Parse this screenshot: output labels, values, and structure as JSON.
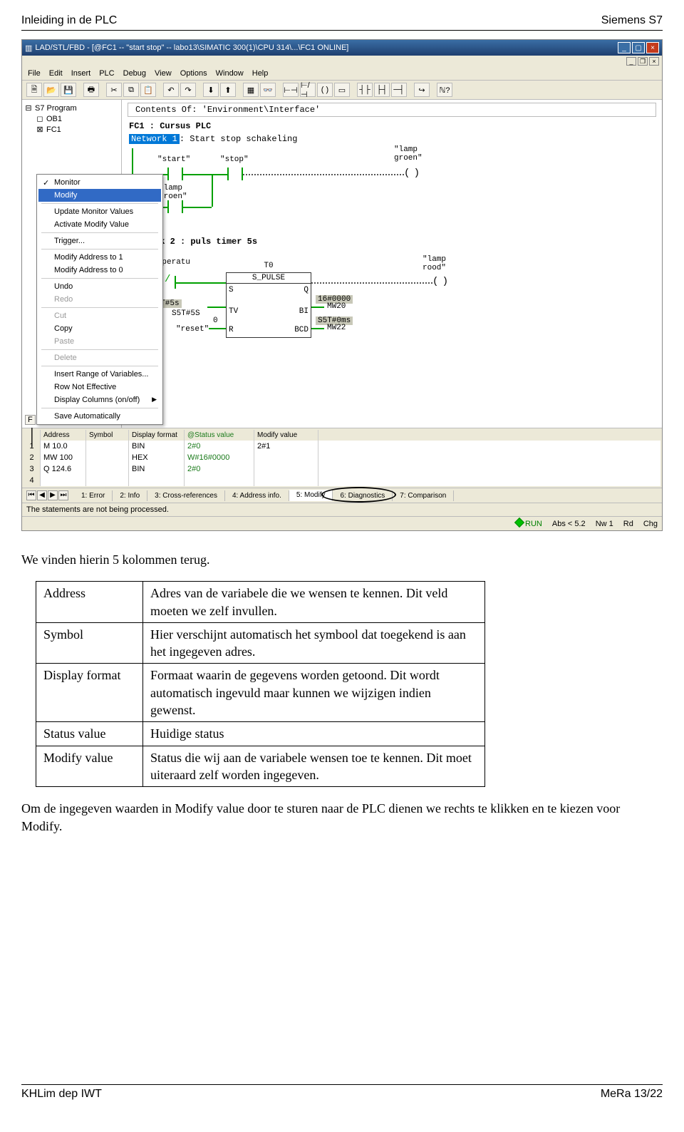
{
  "doc": {
    "header_left": "Inleiding in de PLC",
    "header_right": "Siemens S7",
    "footer_left": "KHLim dep IWT",
    "footer_right": "MeRa 13/22"
  },
  "win": {
    "title": "LAD/STL/FBD - [@FC1 -- \"start stop\" -- labo13\\SIMATIC 300(1)\\CPU 314\\...\\FC1  ONLINE]",
    "menus": [
      "File",
      "Edit",
      "Insert",
      "PLC",
      "Debug",
      "View",
      "Options",
      "Window",
      "Help"
    ],
    "env_title": "Contents Of: 'Environment\\Interface'",
    "tree": [
      {
        "icon": "⊟",
        "label": "S7 Program"
      },
      {
        "icon": "◻",
        "label": "OB1"
      },
      {
        "icon": "⊠",
        "label": "FC1"
      }
    ],
    "fc_title": "FC1 : Cursus PLC",
    "net1_title": "Network 1: Start stop schakeling",
    "net1": {
      "start": "\"start\"",
      "stop": "\"stop\"",
      "lamp": "\"lamp\ngroen\"",
      "feedback": "\"lamp\ngroen\""
    },
    "net2_title": "Network 2 : puls timer 5s",
    "net2": {
      "temp": "\"temperatu\nur\"",
      "t0": "T0",
      "spulse": "S_PULSE",
      "reset": "\"reset\"",
      "lamp_rood": "\"lamp\nrood\"",
      "s5t5s": "S5T#5s",
      "s5t5s_tv": "S5T#5S",
      "zero": "0",
      "hex0": "16#0000",
      "mw20": "MW20",
      "s5t0ms": "S5T#0ms",
      "mw22": "MW22",
      "pin_s": "S",
      "pin_q": "Q",
      "pin_tv": "TV",
      "pin_bi": "BI",
      "pin_r": "R",
      "pin_bcd": "BCD"
    },
    "context_menu": [
      {
        "label": "Monitor",
        "checked": true
      },
      {
        "label": "Modify",
        "selected": true
      },
      {
        "sep": true
      },
      {
        "label": "Update Monitor Values"
      },
      {
        "label": "Activate Modify Value"
      },
      {
        "sep": true
      },
      {
        "label": "Trigger...",
        "arrow": false
      },
      {
        "sep": true
      },
      {
        "label": "Modify Address to 1"
      },
      {
        "label": "Modify Address to 0"
      },
      {
        "sep": true
      },
      {
        "label": "Undo"
      },
      {
        "label": "Redo",
        "disabled": true
      },
      {
        "sep": true
      },
      {
        "label": "Cut",
        "disabled": true
      },
      {
        "label": "Copy"
      },
      {
        "label": "Paste",
        "disabled": true
      },
      {
        "sep": true
      },
      {
        "label": "Delete",
        "disabled": true
      },
      {
        "sep": true
      },
      {
        "label": "Insert Range of Variables..."
      },
      {
        "label": "Row Not Effective"
      },
      {
        "label": "Display Columns (on/off)",
        "arrow": true
      },
      {
        "sep": true
      },
      {
        "label": "Save Automatically"
      }
    ],
    "vat_headers": {
      "addr": "Address",
      "sym": "Symbol",
      "fmt": "Display format",
      "stat": "@Status value",
      "mod": "Modify value"
    },
    "vat_rows": [
      {
        "n": "1",
        "addr": "M    10.0",
        "sym": "",
        "fmt": "BIN",
        "stat": "2#0",
        "mod": "2#1"
      },
      {
        "n": "2",
        "addr": "MW   100",
        "sym": "",
        "fmt": "HEX",
        "stat": "W#16#0000",
        "mod": ""
      },
      {
        "n": "3",
        "addr": "Q    124.6",
        "sym": "",
        "fmt": "BIN",
        "stat": "2#0",
        "mod": ""
      },
      {
        "n": "4",
        "addr": "",
        "sym": "",
        "fmt": "",
        "stat": "",
        "mod": ""
      }
    ],
    "bottom_tabs": [
      "1: Error",
      "2: Info",
      "3: Cross-references",
      "4: Address info.",
      "5: Modify",
      "6: Diagnostics",
      "7: Comparison"
    ],
    "status1": "The statements are not being processed.",
    "status2": {
      "run": "RUN",
      "abs": "Abs < 5.2",
      "nw": "Nw 1",
      "rd": "Rd",
      "chg": "Chg"
    },
    "mini_tab": "F"
  },
  "body": {
    "p1": "We vinden hierin 5 kolommen terug.",
    "p2": "Om de ingegeven waarden in Modify value door te sturen naar de PLC dienen we rechts te klikken en te kiezen voor Modify.",
    "table": [
      [
        "Address",
        "Adres van de variabele die we wensen te kennen. Dit veld moeten we zelf invullen."
      ],
      [
        "Symbol",
        "Hier verschijnt automatisch het symbool dat toegekend is aan het ingegeven adres."
      ],
      [
        "Display format",
        "Formaat waarin de gegevens worden getoond. Dit wordt automatisch ingevuld maar kunnen we wijzigen indien gewenst."
      ],
      [
        "Status value",
        "Huidige status"
      ],
      [
        "Modify value",
        "Status die wij aan de variabele wensen toe te kennen. Dit moet uiteraard zelf worden ingegeven."
      ]
    ]
  }
}
